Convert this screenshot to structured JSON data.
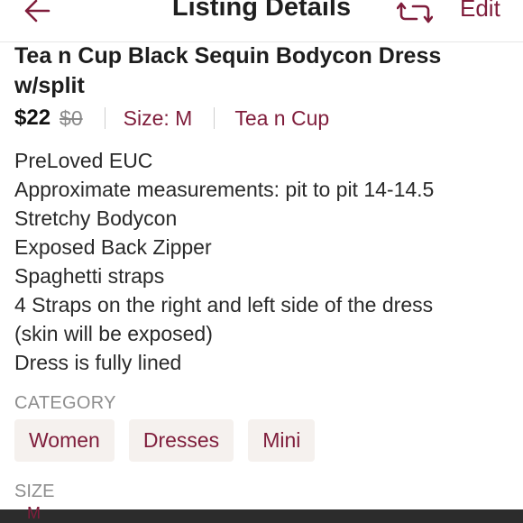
{
  "header": {
    "title": "Listing Details",
    "edit_label": "Edit",
    "accent_color": "#7f1d3b"
  },
  "listing": {
    "title": "Tea n Cup Black Sequin Bodycon Dress w/split",
    "price": "$22",
    "original_price": "$0",
    "size": "Size: M",
    "brand": "Tea n Cup",
    "description_lines": [
      "PreLoved EUC",
      "Approximate measurements: pit to pit 14-14.5",
      "Stretchy Bodycon",
      "Exposed Back Zipper",
      "Spaghetti straps",
      "4 Straps on the right and left side of the dress",
      "(skin will be exposed)",
      "Dress is fully lined"
    ]
  },
  "category": {
    "label": "CATEGORY",
    "chips": [
      "Women",
      "Dresses",
      "Mini"
    ]
  },
  "size_section": {
    "label": "SIZE",
    "value": "M"
  },
  "icons": {
    "back": "arrow-left-icon",
    "share": "repost-icon"
  }
}
